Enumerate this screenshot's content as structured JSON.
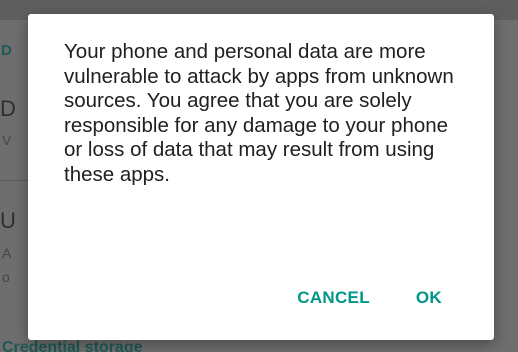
{
  "background": {
    "hints": [
      "D",
      "D",
      "V",
      "U",
      "A",
      "o"
    ],
    "footer": "Credential storage"
  },
  "dialog": {
    "message": "Your phone and personal data are more vulnerable to attack by apps from unknown sources. You agree that you are solely responsible for any damage to your phone or loss of data that may result from using these apps.",
    "cancel_label": "CANCEL",
    "ok_label": "OK"
  },
  "colors": {
    "accent": "#009688",
    "scrim": "#6e6e6e",
    "dialog_bg": "#ffffff",
    "text": "#202020"
  }
}
